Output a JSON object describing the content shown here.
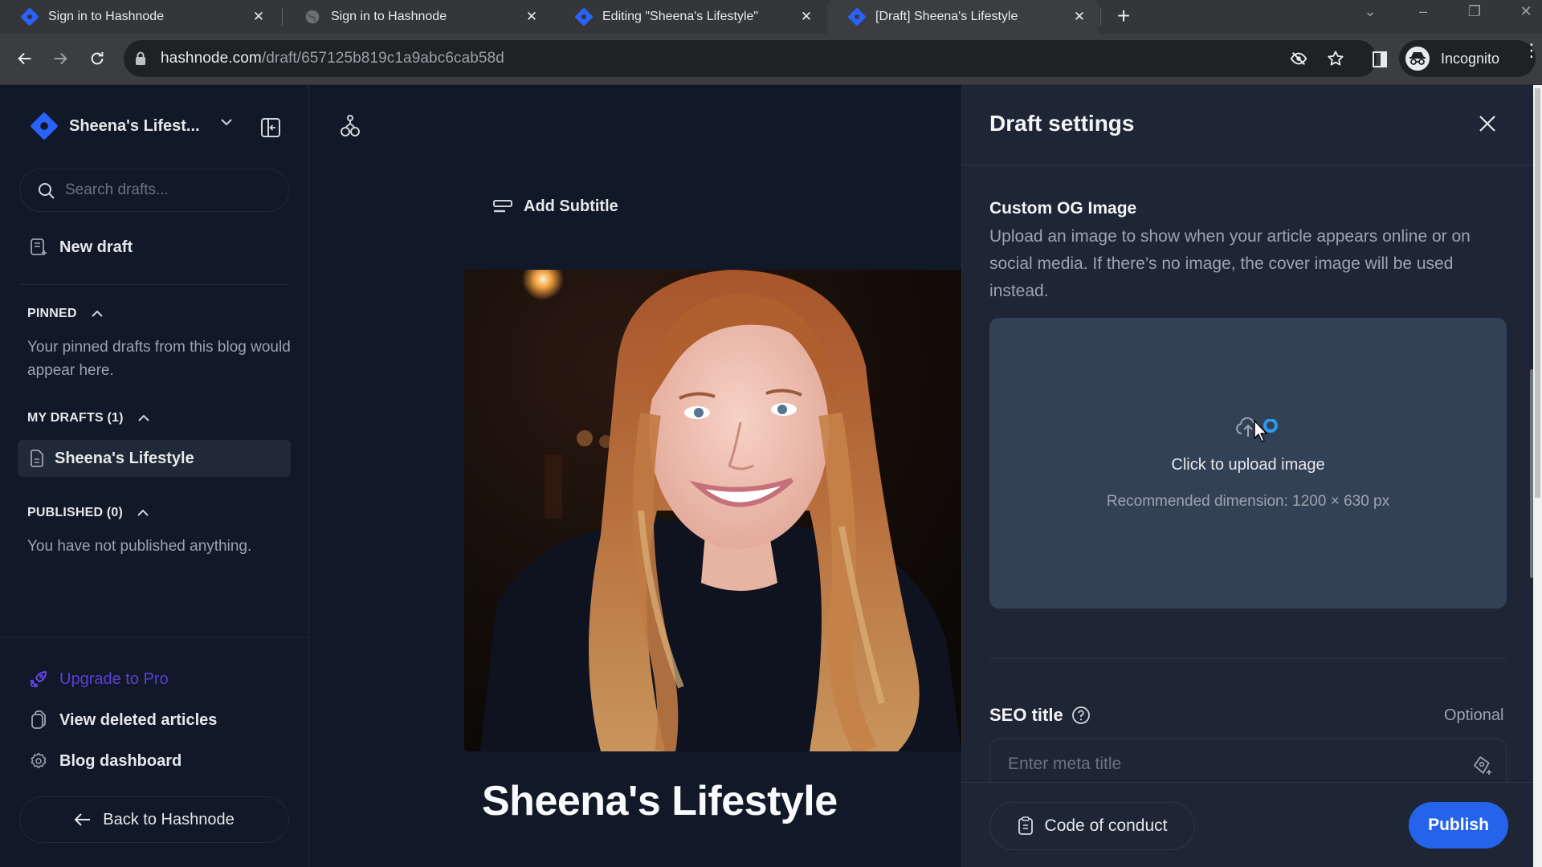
{
  "browser": {
    "tabs": [
      {
        "title": "Sign in to Hashnode",
        "favicon": "hashnode-logo",
        "active": false
      },
      {
        "title": "Sign in to Hashnode",
        "favicon": "globe-icon",
        "active": false
      },
      {
        "title": "Editing \"Sheena's Lifestyle\"",
        "favicon": "hashnode-logo",
        "active": false
      },
      {
        "title": "[Draft] Sheena's Lifestyle",
        "favicon": "hashnode-logo",
        "active": true
      }
    ],
    "url_host": "hashnode.com",
    "url_path": "/draft/657125b819c1a9abc6cab58d",
    "profile_label": "Incognito"
  },
  "sidebar": {
    "blog_name": "Sheena's Lifest...",
    "search_placeholder": "Search drafts...",
    "new_draft_label": "New draft",
    "pinned": {
      "heading": "PINNED",
      "empty_text": "Your pinned drafts from this blog would appear here."
    },
    "my_drafts": {
      "heading": "MY DRAFTS (1)",
      "items": [
        {
          "title": "Sheena's Lifestyle"
        }
      ]
    },
    "published": {
      "heading": "PUBLISHED (0)",
      "empty_text": "You have not published anything."
    },
    "footer_links": {
      "upgrade": "Upgrade to Pro",
      "deleted": "View deleted articles",
      "dashboard": "Blog dashboard"
    },
    "back_label": "Back to Hashnode"
  },
  "editor": {
    "add_subtitle_label": "Add Subtitle",
    "title": "Sheena's Lifestyle",
    "cover_alt": "Cover photo of a smiling woman with long auburn hair"
  },
  "draft_settings": {
    "title": "Draft settings",
    "og_image": {
      "heading": "Custom OG Image",
      "description": "Upload an image to show when your article appears online or on social media. If there’s no image, the cover image will be used instead.",
      "upload_label": "Click to upload image",
      "recommended": "Recommended dimension: 1200 × 630 px"
    },
    "seo_title": {
      "label": "SEO title",
      "optional_label": "Optional",
      "placeholder": "Enter meta title",
      "value": ""
    },
    "code_of_conduct_label": "Code of conduct",
    "publish_label": "Publish"
  },
  "colors": {
    "brand": "#2962ff",
    "publish": "#2563eb",
    "upgrade": "#6d4aff"
  }
}
